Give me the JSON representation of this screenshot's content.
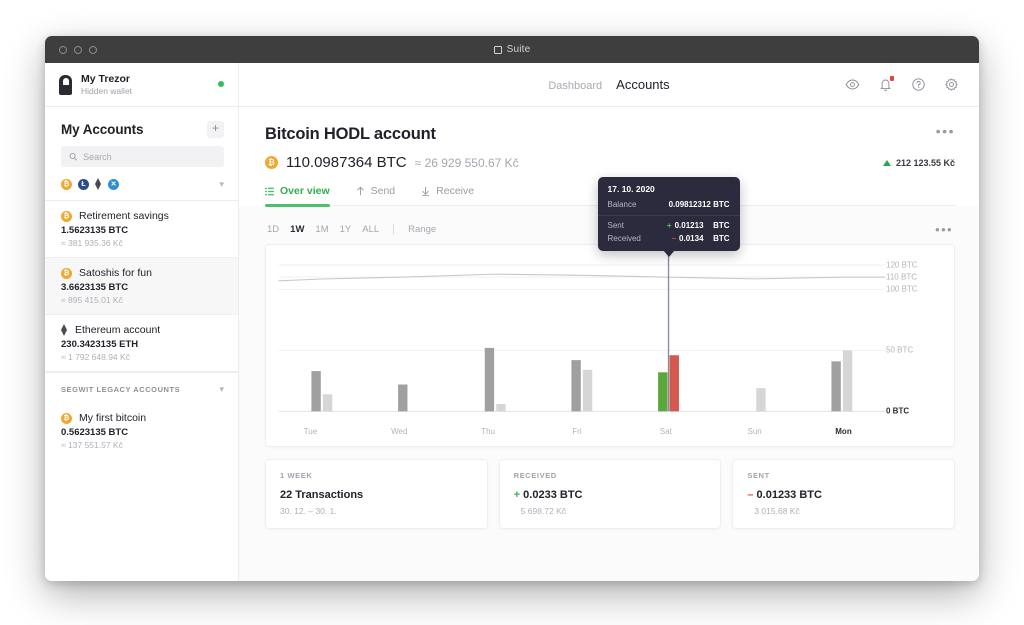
{
  "titlebar": {
    "app_name": "Suite",
    "logo_icon": "suite-logo-icon"
  },
  "device": {
    "name": "My Trezor",
    "subtitle": "Hidden wallet",
    "status_color": "#30c05a",
    "icon": "trezor-device-icon"
  },
  "sidebar": {
    "header": "My Accounts",
    "add_label": "+",
    "search": {
      "placeholder": "Search",
      "value": "",
      "icon": "search-icon"
    },
    "coin_filters": [
      {
        "name": "btc",
        "symbol": "₿",
        "color": "#f0a92f"
      },
      {
        "name": "ltc",
        "symbol": "Ł",
        "color": "#2b4c86"
      },
      {
        "name": "eth",
        "symbol": "",
        "color": "#4a4a55"
      },
      {
        "name": "xrp",
        "symbol": "✕",
        "color": "#2f8fd6"
      }
    ],
    "accounts": [
      {
        "coin": "btc",
        "label": "Retirement savings",
        "amount": "1.5623135 BTC",
        "fiat": "≈ 381 935.36 Kč",
        "active": false
      },
      {
        "coin": "btc",
        "label": "Satoshis for fun",
        "amount": "3.6623135 BTC",
        "fiat": "≈ 895 415.01 Kč",
        "active": true
      },
      {
        "coin": "eth",
        "label": "Ethereum account",
        "amount": "230.3423135 ETH",
        "fiat": "≈ 1 792 648.94 Kč",
        "active": false
      }
    ],
    "legacy_header": "SEGWIT LEGACY ACCOUNTS",
    "legacy_accounts": [
      {
        "coin": "btc",
        "label": "My first bitcoin",
        "amount": "0.5623135 BTC",
        "fiat": "≈ 137 551.57 Kč",
        "active": false
      }
    ]
  },
  "topbar": {
    "nav": [
      {
        "label": "Dashboard",
        "active": false
      },
      {
        "label": "Accounts",
        "active": true
      }
    ],
    "icons": [
      "eye-icon",
      "bell-icon",
      "help-icon",
      "gear-icon"
    ],
    "notification_badge_color": "#e0483c"
  },
  "account": {
    "title": "Bitcoin HODL account",
    "menu_label": "•••",
    "coin_symbol": "₿",
    "balance": "110.0987364 BTC",
    "balance_fiat": "≈ 26 929 550.67 Kč",
    "change_value": "212 123.55 Kč",
    "change_direction": "up",
    "change_color": "#30a14e",
    "tabs": [
      {
        "label": "Over view",
        "icon": "list-icon",
        "active": true
      },
      {
        "label": "Send",
        "icon": "arrow-up-icon",
        "active": false
      },
      {
        "label": "Receive",
        "icon": "arrow-down-icon",
        "active": false
      }
    ]
  },
  "chart_controls": {
    "ranges": [
      {
        "label": "1D",
        "active": false
      },
      {
        "label": "1W",
        "active": true
      },
      {
        "label": "1M",
        "active": false
      },
      {
        "label": "1Y",
        "active": false
      },
      {
        "label": "ALL",
        "active": false
      }
    ],
    "range_picker_label": "Range",
    "menu_label": "•••"
  },
  "tooltip": {
    "date": "17. 10. 2020",
    "rows": [
      {
        "key": "Balance",
        "sign": "",
        "value": "0.09812312 BTC",
        "unit": ""
      },
      {
        "key": "Sent",
        "sign": "+",
        "value": "0.01213",
        "unit": "BTC"
      },
      {
        "key": "Received",
        "sign": "–",
        "value": "0.0134",
        "unit": "BTC"
      }
    ]
  },
  "summary_cards": [
    {
      "label": "1 WEEK",
      "main": "22 Transactions",
      "sign": "",
      "sub": "30. 12. – 30. 1."
    },
    {
      "label": "RECEIVED",
      "main": "0.0233 BTC",
      "sign": "+",
      "sub": "5 698.72 Kč"
    },
    {
      "label": "SENT",
      "main": "0.01233 BTC",
      "sign": "–",
      "sub": "3 015.68 Kč"
    }
  ],
  "chart_data": {
    "type": "bar",
    "title": "",
    "xlabel": "",
    "ylabel": "BTC",
    "categories": [
      "Tue",
      "Wed",
      "Thu",
      "Fri",
      "Sat",
      "Sun",
      "Mon"
    ],
    "highlight_category": "Mon",
    "selected_category": "Sat",
    "ytick_labels": [
      "0 BTC",
      "50 BTC",
      "100 BTC",
      "110 BTC",
      "120 BTC"
    ],
    "ytick_values": [
      0,
      50,
      100,
      110,
      120
    ],
    "ylim": [
      0,
      125
    ],
    "grid": true,
    "legend": "none",
    "series": [
      {
        "name": "Sent",
        "color": "#a0a0a0",
        "values": [
          33,
          22,
          52,
          42,
          32,
          0,
          41
        ]
      },
      {
        "name": "Received",
        "color": "#d6d6d6",
        "values": [
          14,
          0,
          6,
          34,
          46,
          19,
          50
        ]
      }
    ],
    "selected_bars": {
      "sent_color": "#5aa83c",
      "received_color": "#d4584f",
      "category": "Sat"
    },
    "balance_line": {
      "name": "Balance",
      "color": "#c8c8cc",
      "values": [
        108.5,
        110.2,
        112.5,
        111.5,
        110.0,
        108.6,
        110.0
      ]
    }
  }
}
